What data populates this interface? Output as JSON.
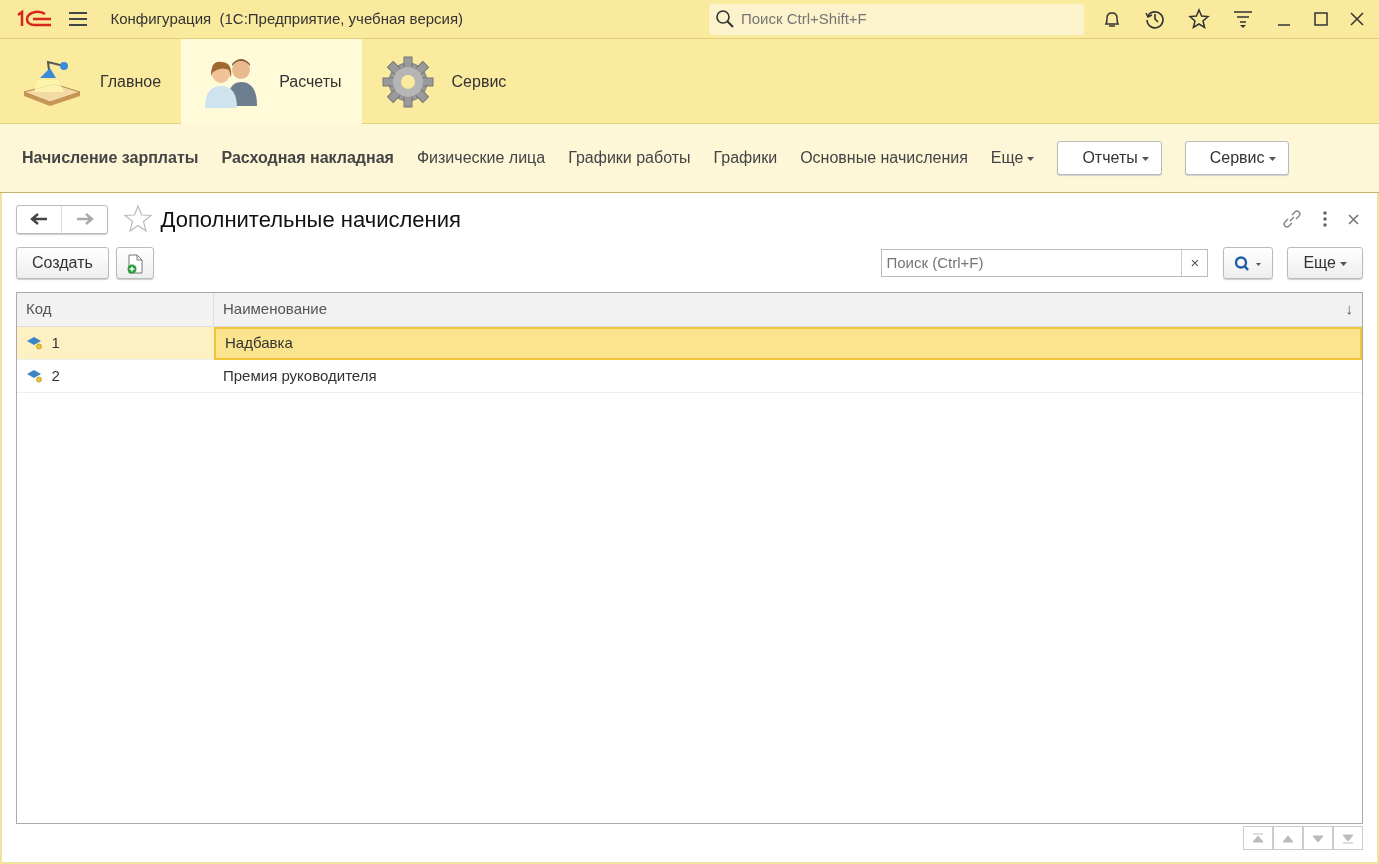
{
  "window": {
    "title": "Конфигурация  (1С:Предприятие, учебная версия)",
    "search_placeholder": "Поиск Ctrl+Shift+F"
  },
  "sections": [
    {
      "label": "Главное",
      "selected": false,
      "kind": "desk"
    },
    {
      "label": "Расчеты",
      "selected": true,
      "kind": "people"
    },
    {
      "label": "Сервис",
      "selected": false,
      "kind": "gear"
    }
  ],
  "nav": [
    {
      "label": "Начисление зарплаты",
      "kind": "bold"
    },
    {
      "label": "Расходная накладная",
      "kind": "bold"
    },
    {
      "label": "Физические лица",
      "kind": "link"
    },
    {
      "label": "Графики работы",
      "kind": "link"
    },
    {
      "label": "Графики",
      "kind": "link"
    },
    {
      "label": "Основные начисления",
      "kind": "link"
    },
    {
      "label": "Еще",
      "kind": "more"
    },
    {
      "label": "Отчеты",
      "kind": "menu"
    },
    {
      "label": "Сервис",
      "kind": "menu"
    }
  ],
  "form": {
    "title": "Дополнительные начисления",
    "create_button": "Создать",
    "search_placeholder": "Поиск (Ctrl+F)",
    "clear": "×",
    "more_button": "Еще"
  },
  "table": {
    "columns": [
      {
        "label": "Код"
      },
      {
        "label": "Наименование",
        "sort": "↓"
      }
    ],
    "rows": [
      {
        "code": "1",
        "name": "Надбавка",
        "selected": true
      },
      {
        "code": "2",
        "name": "Премия руководителя",
        "selected": false
      }
    ]
  }
}
